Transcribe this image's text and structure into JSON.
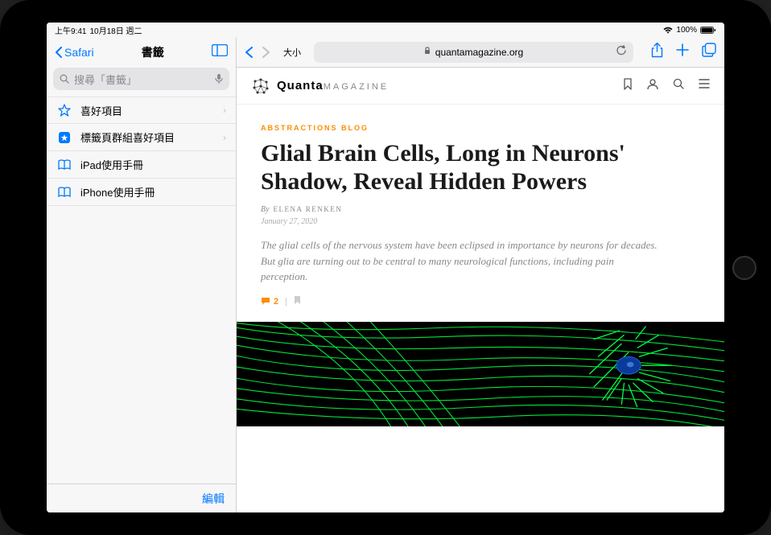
{
  "status": {
    "time": "上午9:41",
    "date": "10月18日 週二",
    "battery": "100%"
  },
  "sidebar": {
    "back_label": "Safari",
    "title": "書籤",
    "search_placeholder": "搜尋「書籤」",
    "items": [
      {
        "icon": "star-outline",
        "label": "喜好項目",
        "chevron": true
      },
      {
        "icon": "star-box",
        "label": "標籤頁群組喜好項目",
        "chevron": true
      },
      {
        "icon": "book",
        "label": "iPad使用手冊",
        "chevron": false
      },
      {
        "icon": "book",
        "label": "iPhone使用手冊",
        "chevron": false
      }
    ],
    "edit_label": "編輯"
  },
  "toolbar": {
    "size_label": "大小",
    "url": "quantamagazine.org"
  },
  "site": {
    "logo_bold": "Quanta",
    "logo_light": "MAGAZINE"
  },
  "article": {
    "category": "ABSTRACTIONS BLOG",
    "headline": "Glial Brain Cells, Long in Neurons' Shadow, Reveal Hidden Powers",
    "by_prefix": "By",
    "author": "ELENA RENKEN",
    "date": "January 27, 2020",
    "summary": "The glial cells of the nervous system have been eclipsed in importance by neurons for decades. But glia are turning out to be central to many neurological functions, including pain perception.",
    "comment_count": "2"
  }
}
